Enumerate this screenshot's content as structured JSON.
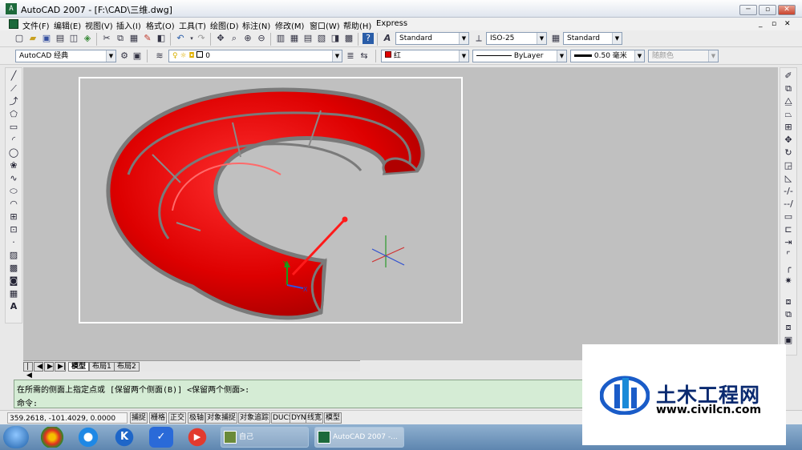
{
  "window": {
    "title": "AutoCAD 2007 - [F:\\CAD\\三维.dwg]",
    "app_icon": "A"
  },
  "window_controls": {
    "min": "─",
    "restore": "▫",
    "close": "✕",
    "doc_min": "_",
    "doc_restore": "▫",
    "doc_close": "✕"
  },
  "menu": [
    "文件(F)",
    "编辑(E)",
    "视图(V)",
    "插入(I)",
    "格式(O)",
    "工具(T)",
    "绘图(D)",
    "标注(N)",
    "修改(M)",
    "窗口(W)",
    "帮助(H)",
    "Express"
  ],
  "styles_toolbar": {
    "text_style": "Standard",
    "dim_style": "ISO-25",
    "table_style": "Standard"
  },
  "workspace": {
    "value": "AutoCAD 经典"
  },
  "layer": {
    "value": "0"
  },
  "properties": {
    "color": "红",
    "color_hex": "#e00000",
    "linetype": "ByLayer",
    "lineweight": "0.50 毫米",
    "plotstyle": "随颜色"
  },
  "tabs": {
    "nav": [
      "|◀",
      "◀",
      "▶",
      "▶|"
    ],
    "items": [
      "模型",
      "布局1",
      "布局2"
    ]
  },
  "command": {
    "line1": "在所需的侧面上指定点或 [保留两个侧面(B)] <保留两个侧面>:",
    "line2": "命令:"
  },
  "status": {
    "coords": "359.2618,  -101.4029, 0.0000",
    "buttons": [
      "捕捉",
      "栅格",
      "正交",
      "极轴",
      "对象捕捉",
      "对象追踪",
      "DUCS",
      "DYN",
      "线宽",
      "模型"
    ]
  },
  "taskbar": {
    "tasks": [
      "自己",
      "AutoCAD 2007 -..."
    ]
  },
  "watermark": {
    "brand": "土木工程网",
    "url": "www.civilcn.com"
  },
  "ucs": {
    "x_label": "X",
    "y_label": "Y"
  }
}
